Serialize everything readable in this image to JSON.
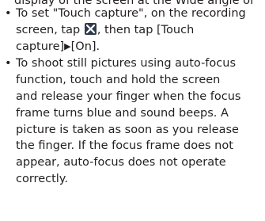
{
  "top_partial_line": "display of the screen at the Wide angle of",
  "bullets": [
    {
      "lines": {
        "l1": "To set \"Touch capture\", on the recording",
        "l2_a": "screen, tap",
        "l2_b": ", then tap [Touch",
        "l3_a": "capture]",
        "l3_arrow": "▶",
        "l3_b": "[On]."
      },
      "icon": "touch-capture-settings-icon"
    },
    {
      "lines": [
        "To shoot still pictures using auto-focus",
        "function, touch and hold the screen",
        "and release your finger when the focus",
        "frame turns blue and sound beeps. A",
        "picture is taken as soon as you release",
        "the finger. If the focus frame does not",
        "appear, auto-focus does not operate",
        "correctly."
      ]
    }
  ],
  "colors": {
    "text": "#231f20",
    "icon_bg": "#2f3b4c"
  }
}
